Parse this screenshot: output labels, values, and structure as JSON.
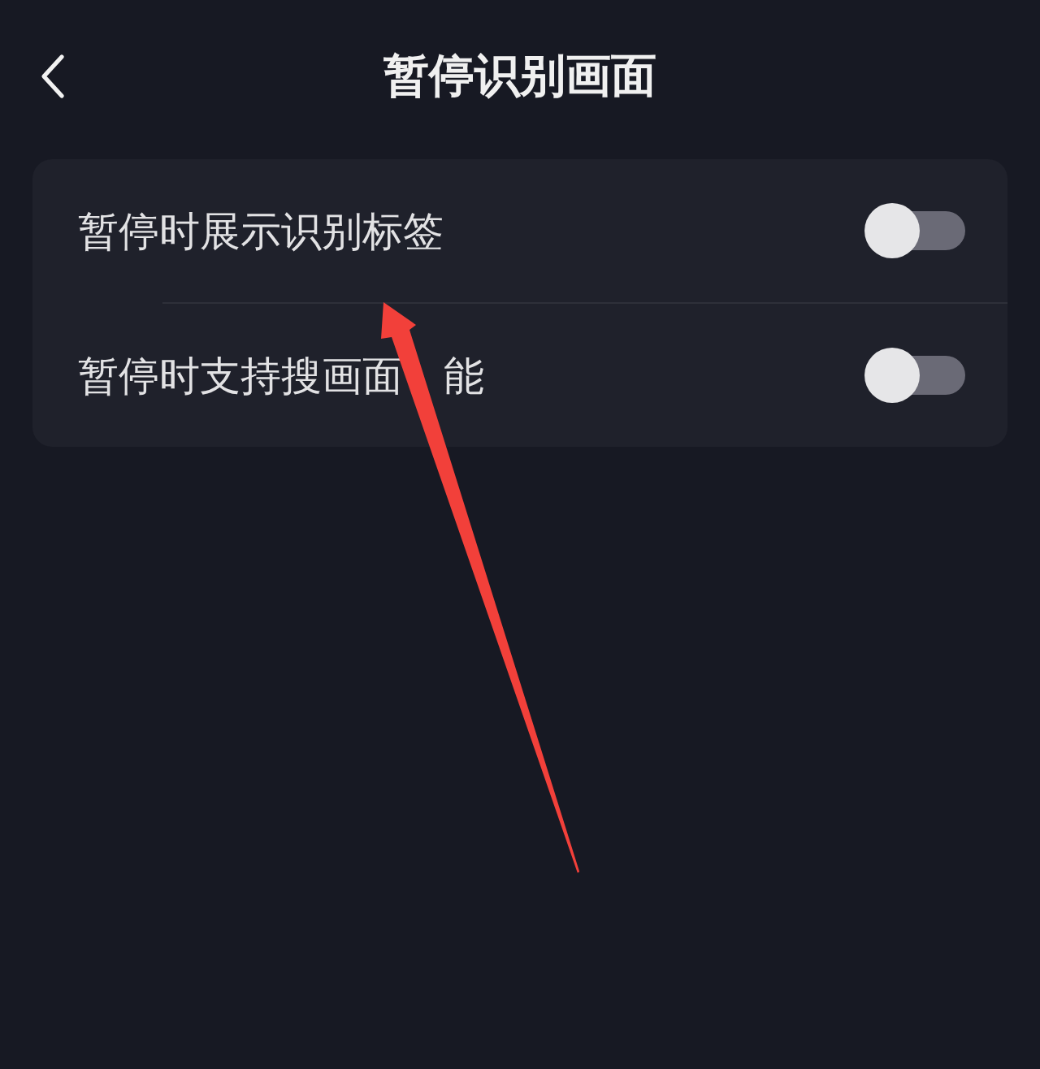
{
  "header": {
    "title": "暂停识别画面"
  },
  "settings": [
    {
      "label_parts": [
        "暂停时展示识别标签"
      ],
      "on": false
    },
    {
      "label_parts": [
        "暂停时支持搜画面",
        "能"
      ],
      "on": false
    }
  ],
  "annotations": [
    {
      "kind": "arrow"
    }
  ]
}
